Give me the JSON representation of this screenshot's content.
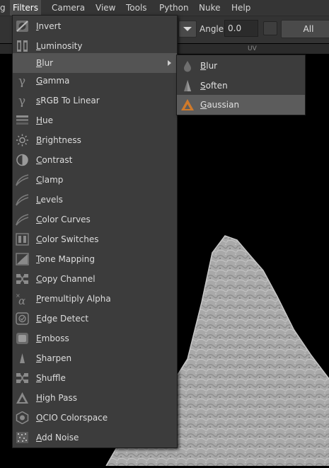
{
  "menubar": {
    "items": [
      {
        "label": "g"
      },
      {
        "label": "Filters"
      },
      {
        "label": "Camera"
      },
      {
        "label": "View"
      },
      {
        "label": "Tools"
      },
      {
        "label": "Python"
      },
      {
        "label": "Nuke"
      },
      {
        "label": "Help"
      }
    ]
  },
  "toolbar": {
    "angle_label": "Angle",
    "angle_value": "0.0",
    "all_label": "All",
    "strip_hint": "UV"
  },
  "filters_menu": {
    "items": [
      {
        "label": "Invert",
        "icon": "invert-icon"
      },
      {
        "label": "Luminosity",
        "icon": "luminosity-icon"
      },
      {
        "label": "Blur",
        "icon": "blur-icon",
        "has_submenu": true
      },
      {
        "label": "Gamma",
        "icon": "gamma-icon"
      },
      {
        "label": "sRGB To Linear",
        "icon": "gamma-icon"
      },
      {
        "label": "Hue",
        "icon": "hue-icon"
      },
      {
        "label": "Brightness",
        "icon": "brightness-icon"
      },
      {
        "label": "Contrast",
        "icon": "contrast-icon"
      },
      {
        "label": "Clamp",
        "icon": "curve-icon"
      },
      {
        "label": "Levels",
        "icon": "curve-icon"
      },
      {
        "label": "Color Curves",
        "icon": "curve-icon"
      },
      {
        "label": "Color Switches",
        "icon": "switches-icon"
      },
      {
        "label": "Tone Mapping",
        "icon": "tonemap-icon"
      },
      {
        "label": "Copy Channel",
        "icon": "channel-icon"
      },
      {
        "label": "Premultiply Alpha",
        "icon": "alpha-icon"
      },
      {
        "label": "Edge Detect",
        "icon": "edge-icon"
      },
      {
        "label": "Emboss",
        "icon": "emboss-icon"
      },
      {
        "label": "Sharpen",
        "icon": "sharpen-icon"
      },
      {
        "label": "Shuffle",
        "icon": "shuffle-icon"
      },
      {
        "label": "High Pass",
        "icon": "highpass-icon"
      },
      {
        "label": "OCIO Colorspace",
        "icon": "ocio-icon"
      },
      {
        "label": "Add Noise",
        "icon": "noise-icon"
      }
    ]
  },
  "blur_submenu": {
    "items": [
      {
        "label": "Blur",
        "icon": "drop-icon"
      },
      {
        "label": "Soften",
        "icon": "soften-icon"
      },
      {
        "label": "Gaussian",
        "icon": "gaussian-icon"
      }
    ]
  },
  "colors": {
    "menu_bg": "#3c3c3c",
    "highlight": "#545454",
    "gaussian_accent": "#d07a2a"
  }
}
